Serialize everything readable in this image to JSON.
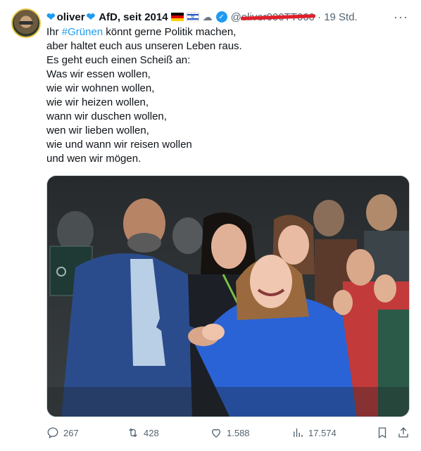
{
  "post": {
    "author_name": "oliver",
    "author_suffix": "AfD, seit 2014",
    "handle": "@oliver000TT000",
    "time": "· 19 Std.",
    "more_label": "···",
    "text_lines": [
      {
        "before": "Ihr ",
        "hashtag": "#Grünen",
        "after": " könnt gerne Politik machen,"
      },
      "aber haltet euch aus unseren Leben raus.",
      "Es geht euch einen Scheiß an:",
      "Was wir essen wollen,",
      "wie wir wohnen wollen,",
      "wie wir heizen wollen,",
      "wann wir duschen wollen,",
      "wen wir lieben wollen,",
      "wie und wann wir reisen wollen",
      "und wen wir mögen."
    ]
  },
  "actions": {
    "replies": "267",
    "reposts": "428",
    "likes": "1.588",
    "views": "17.574"
  },
  "icons": {
    "heart_emoji": "blue-heart-icon",
    "flags": [
      "germany-flag-icon",
      "israel-flag-icon"
    ],
    "cloud": "cloud-icon",
    "verified": "verified-badge-icon"
  },
  "colors": {
    "accent": "#1d9bf0",
    "secondary_text": "#536471",
    "redaction": "#e0202a"
  }
}
